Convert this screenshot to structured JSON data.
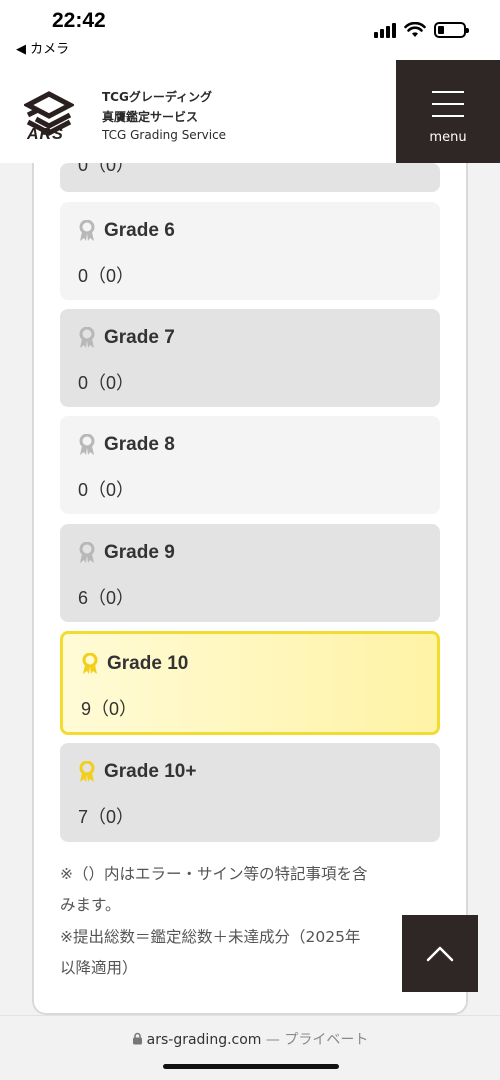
{
  "status_bar": {
    "time": "22:42",
    "back_app": "◀ カメラ"
  },
  "header": {
    "logo_text": "ARS",
    "brand_line1": "TCGグレーディング",
    "brand_line2": "真贋鑑定サービス",
    "brand_line3": "TCG Grading Service",
    "menu_label": "menu"
  },
  "partial_box": {
    "count": "0（0）"
  },
  "grades": [
    {
      "title": "Grade 6",
      "count": "0（0）",
      "style": "light",
      "medal": "gray"
    },
    {
      "title": "Grade 7",
      "count": "0（0）",
      "style": "dark",
      "medal": "gray"
    },
    {
      "title": "Grade 8",
      "count": "0（0）",
      "style": "light",
      "medal": "gray"
    },
    {
      "title": "Grade 9",
      "count": "6（0）",
      "style": "dark",
      "medal": "gray"
    },
    {
      "title": "Grade 10",
      "count": "9（0）",
      "style": "gold",
      "medal": "gold"
    },
    {
      "title": "Grade 10+",
      "count": "7（0）",
      "style": "dark",
      "medal": "gold"
    }
  ],
  "notes": {
    "note1_line1": "※（）内はエラー・サイン等の特記事項を含",
    "note1_line2": "みます。",
    "note2_line1": "※提出総数＝鑑定総数＋未達成分（2025年",
    "note2_line2": "以降適用）"
  },
  "browser": {
    "url": "ars-grading.com",
    "privacy": "— プライベート"
  },
  "colors": {
    "accent_dark": "#2f2626",
    "gold_border": "#f3dc32",
    "gold_bg": "#fff3a6",
    "medal_gray": "#b8b8b8",
    "medal_gold": "#f2cf1a"
  }
}
